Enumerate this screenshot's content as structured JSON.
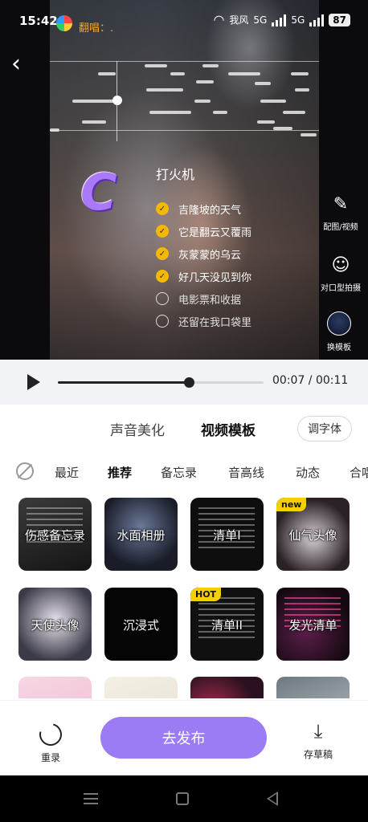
{
  "status_bar": {
    "time": "15:42",
    "app_text": "翻唱：.",
    "right_text": "我风",
    "network_1": "5G",
    "network_2": "5G",
    "battery": "87"
  },
  "video": {
    "song_title": "打火机",
    "badge_letter": "C",
    "lyrics": [
      {
        "text": "吉隆坡的天气",
        "done": true
      },
      {
        "text": "它是翻云又覆雨",
        "done": true
      },
      {
        "text": "灰蒙蒙的乌云",
        "done": true
      },
      {
        "text": "好几天没见到你",
        "done": true
      },
      {
        "text": "电影票和收据",
        "done": false
      },
      {
        "text": "还留在我口袋里",
        "done": false
      }
    ],
    "actions": [
      {
        "label": "配图/视频",
        "icon": "edit-icon"
      },
      {
        "label": "对口型拍摄",
        "icon": "lip-sync-camera-icon"
      },
      {
        "label": "换模板",
        "icon": "template-thumb-icon"
      }
    ]
  },
  "player": {
    "current": "00:07",
    "total": "00:11",
    "time_text": "00:07 / 00:11",
    "progress": 0.636
  },
  "panel": {
    "tabs": [
      "声音美化",
      "视频模板"
    ],
    "active_tab": 1,
    "font_button": "调字体",
    "categories": [
      "最近",
      "推荐",
      "备忘录",
      "音高线",
      "动态",
      "合唱"
    ],
    "active_category": 1,
    "templates": [
      {
        "label": "伤感备忘录",
        "badge": ""
      },
      {
        "label": "水面相册",
        "badge": ""
      },
      {
        "label": "清单I",
        "badge": ""
      },
      {
        "label": "仙气头像",
        "badge": "new"
      },
      {
        "label": "天使头像",
        "badge": ""
      },
      {
        "label": "沉浸式",
        "badge": ""
      },
      {
        "label": "清单II",
        "badge": "HOT"
      },
      {
        "label": "发光清单",
        "badge": ""
      },
      {
        "label": "",
        "badge": ""
      },
      {
        "label": "",
        "badge": ""
      },
      {
        "label": "",
        "badge": ""
      },
      {
        "label": "",
        "badge": ""
      }
    ]
  },
  "bottom_bar": {
    "reset_label": "重录",
    "publish_label": "去发布",
    "draft_label": "存草稿"
  },
  "colors": {
    "accent": "#9b7cf5",
    "check": "#f5b800",
    "tab_highlight": "#c7ff3a"
  }
}
